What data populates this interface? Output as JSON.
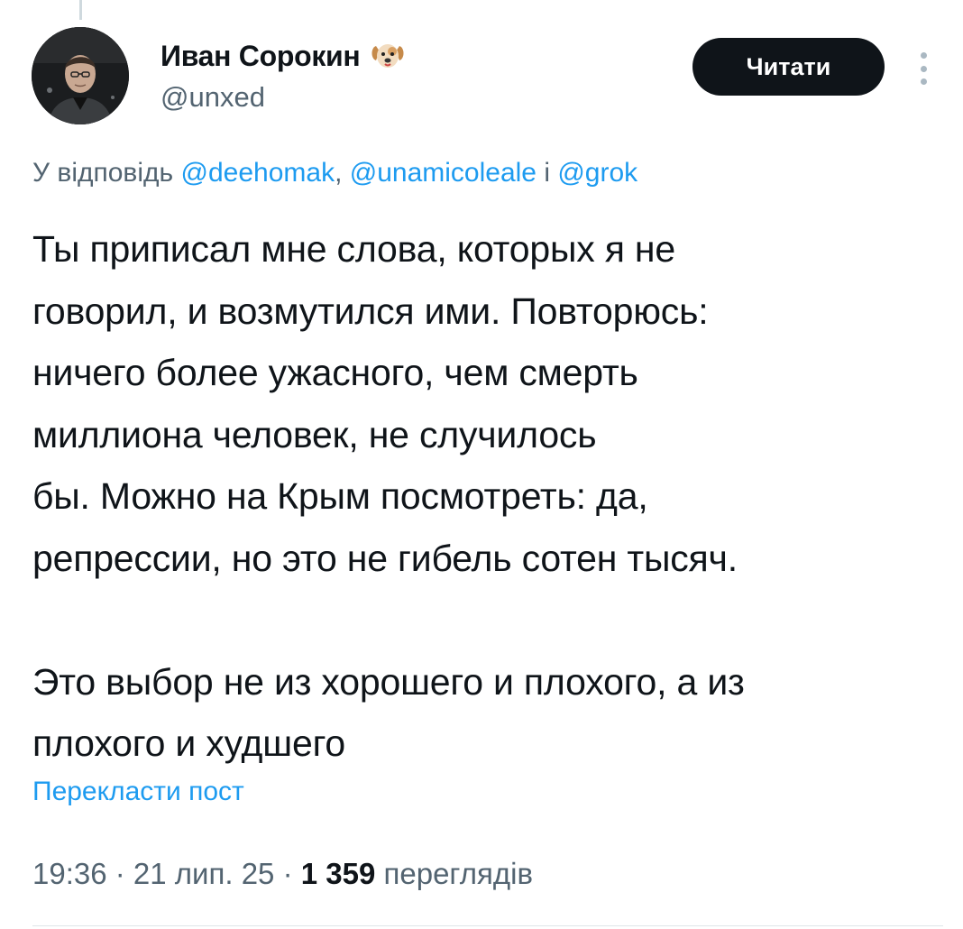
{
  "author": {
    "name": "Иван Сорокин",
    "name_badge_icon": "dog-face-icon",
    "handle": "@unxed",
    "avatar_icon": "user-avatar"
  },
  "header": {
    "follow_label": "Читати",
    "more_icon": "vertical-ellipsis-icon"
  },
  "reply": {
    "prefix": "У відповідь ",
    "mentions": [
      "@deehomak",
      "@unamicoleale",
      "@grok"
    ],
    "separator": ", ",
    "conjunction": " і "
  },
  "tweet": {
    "lines": [
      "Ты приписал мне слова, которых я не",
      "говорил, и возмутился ими. Повторюсь:",
      "ничего более ужасного, чем смерть",
      "миллиона человек, не случилось",
      "бы. Можно на Крым посмотреть: да,",
      "репрессии, но это не гибель сотен тысяч."
    ],
    "lines2": [
      "Это выбор не из хорошего и плохого, а из",
      "плохого и худшего"
    ]
  },
  "translate_label": "Перекласти пост",
  "meta": {
    "time": "19:36",
    "date": "21 лип. 25",
    "dot": " · ",
    "views_count": "1 359",
    "views_label": " переглядів"
  },
  "colors": {
    "text": "#0f1419",
    "secondary": "#536471",
    "link": "#1d9bf0",
    "button_bg": "#0f1419",
    "button_text": "#ffffff"
  }
}
